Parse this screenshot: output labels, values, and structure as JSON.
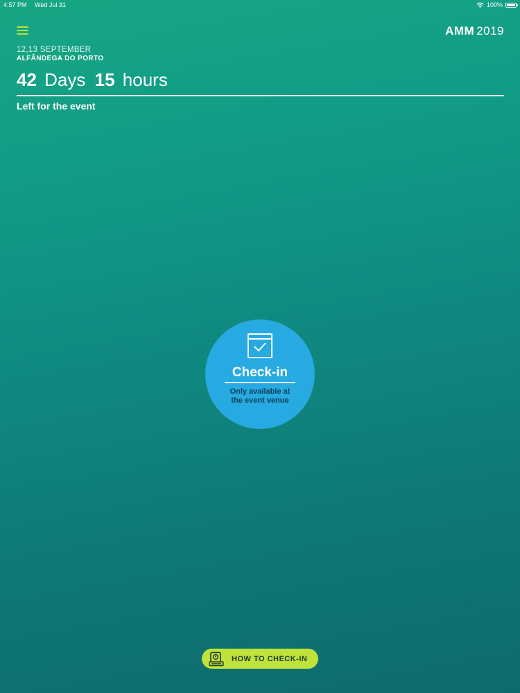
{
  "status_bar": {
    "time": "4:57 PM",
    "date": "Wed Jul 31",
    "battery": "100%"
  },
  "header": {
    "logo_bold": "AMM",
    "logo_year": "2019",
    "dates": "12,13 SEPTEMBER",
    "venue": "ALFÂNDEGA DO PORTO"
  },
  "countdown": {
    "days_value": "42",
    "days_label": "Days",
    "hours_value": "15",
    "hours_label": "hours",
    "caption": "Left for the event"
  },
  "checkin": {
    "title": "Check-in",
    "note_line1": "Only available at",
    "note_line2": "the event venue"
  },
  "howto": {
    "label": "HOW TO CHECK-IN"
  },
  "colors": {
    "accent_green": "#b6e23a",
    "checkin_blue": "#27aae1",
    "button_lime": "#bfe33a"
  },
  "icons": {
    "menu": "menu-icon",
    "wifi": "wifi-icon",
    "battery": "battery-icon",
    "checkin": "calendar-check-icon",
    "howto": "ticket-scan-icon"
  }
}
